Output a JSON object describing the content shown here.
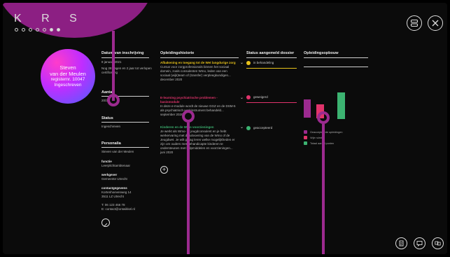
{
  "brand": {
    "logo_text": "K R S"
  },
  "profile": {
    "first_name": "Steven",
    "last_name": "van der Meulen",
    "reg_label": "registernr. 10047",
    "status": "Ingeschreven"
  },
  "col1": {
    "date_header": "Datum van inschrijving",
    "date_value": "8 januari 2021",
    "date_note": "Nog 28 dagen en 2 jaar tot verlopen certificering",
    "points_header": "Aantal",
    "points_value": "20/36",
    "status_header": "Status",
    "status_value": "Ingeschreven",
    "personal_header": "Personalia",
    "person_name": "Steven van der Meulen",
    "function_label": "functie",
    "function_value": "Leerplichtambtenaar",
    "employer_label": "werkgever",
    "employer_value": "Gemeente Utrecht",
    "contact_label": "contactgegevens",
    "address1": "Kortenhoevenweg 14",
    "address2": "3511 LZ Utrecht",
    "phone": "T: 06 123 456 78",
    "email": "E: contact@ontwikkel.nl"
  },
  "history": {
    "header": "Opleidingshistorie",
    "items": [
      {
        "title": "Afbakening en toegang tot de Wet langdurige zorg",
        "desc": "Cursus voor zorgprofessionals binnen het sociaal domein, zoals consulenten Wmo, leden van een sociaal (wijk)team of (transfer) verpleegkundigen...",
        "date": "december 2020"
      },
      {
        "title": "E-learning psychiatrische problemen - basismodule",
        "desc": "In deze e-module wordt de nieuwe GGZ en de DSM-5 als psychiatrisch werkinstrument behandeld...",
        "date": "september 2020"
      },
      {
        "title": "Kinderen en de Wmo voorzieningen",
        "desc": "Je werkt als Wmo- of jeugdconsulent en je hebt werkervaring met de uitvoering van de Wmo of de Jeugdwet. Je wilt graag leren welke mogelijkheden er zijn om ouders met gehandicapte kinderen te ondersteunen met hulpmiddelen en voorzieningen...",
        "date": "juni 2020"
      }
    ]
  },
  "dossier": {
    "header": "Status aangemeld dossier",
    "items": [
      {
        "label": "in behandeling",
        "color": "#e8c21b"
      },
      {
        "label": "geweigerd",
        "color": "#e0336b"
      },
      {
        "label": "geaccepteerd",
        "color": "#3cb371"
      }
    ]
  },
  "buildup": {
    "header": "Opleidingsopbouw",
    "legend": [
      {
        "label": "Geaccepteerde opleidingen",
        "color": "#9c2a8f"
      },
      {
        "label": "Vrije ruimte",
        "color": "#e0336b"
      },
      {
        "label": "Totaal aantal punten",
        "color": "#3cb371"
      }
    ]
  },
  "icons": {
    "menu": "layers-icon",
    "close": "close-icon",
    "doc": "document-icon",
    "chat": "chat-icon",
    "compare": "compare-icon"
  }
}
